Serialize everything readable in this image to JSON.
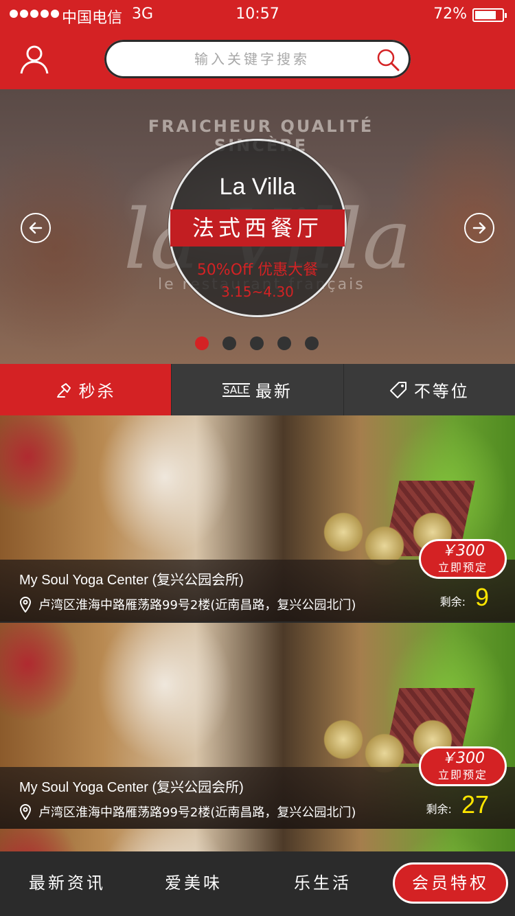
{
  "status_bar": {
    "carrier": "中国电信",
    "network": "3G",
    "time": "10:57",
    "battery_percent": "72%",
    "battery_level": 0.72
  },
  "header": {
    "avatar_icon": "user-icon",
    "search": {
      "placeholder": "输入关键字搜索",
      "icon": "search-icon"
    }
  },
  "banner": {
    "arc_text": "FRAICHEUR QUALITÉ SINCÈRE",
    "script_text": "la Villa",
    "sub_text": "le restaurant français",
    "title": "La Villa",
    "subtitle": "法式西餐厅",
    "offer": "50%Off 优惠大餐",
    "date": "3.15~4.30",
    "slide_count": 5,
    "active_slide": 1
  },
  "tabs": [
    {
      "label": "秒杀",
      "icon": "gavel-icon",
      "active": true
    },
    {
      "label": "最新",
      "badge": "SALE",
      "icon": "sale-icon",
      "active": false
    },
    {
      "label": "不等位",
      "icon": "tag-icon",
      "active": false
    }
  ],
  "cards": [
    {
      "title": "My Soul Yoga Center (复兴公园会所)",
      "address": "卢湾区淮海中路雁荡路99号2楼(近南昌路，复兴公园北门)",
      "price": "￥300",
      "book_label": "立即预定",
      "remain_label": "剩余:",
      "remain": "9"
    },
    {
      "title": "My Soul Yoga Center (复兴公园会所)",
      "address": "卢湾区淮海中路雁荡路99号2楼(近南昌路，复兴公园北门)",
      "price": "￥300",
      "book_label": "立即预定",
      "remain_label": "剩余:",
      "remain": "27"
    }
  ],
  "bottom_nav": {
    "items": [
      "最新资讯",
      "爱美味",
      "乐生活"
    ],
    "member": "会员特权"
  },
  "colors": {
    "brand_red": "#d42224",
    "dark": "#2b2b2b",
    "remain_yellow": "#ffe600"
  }
}
